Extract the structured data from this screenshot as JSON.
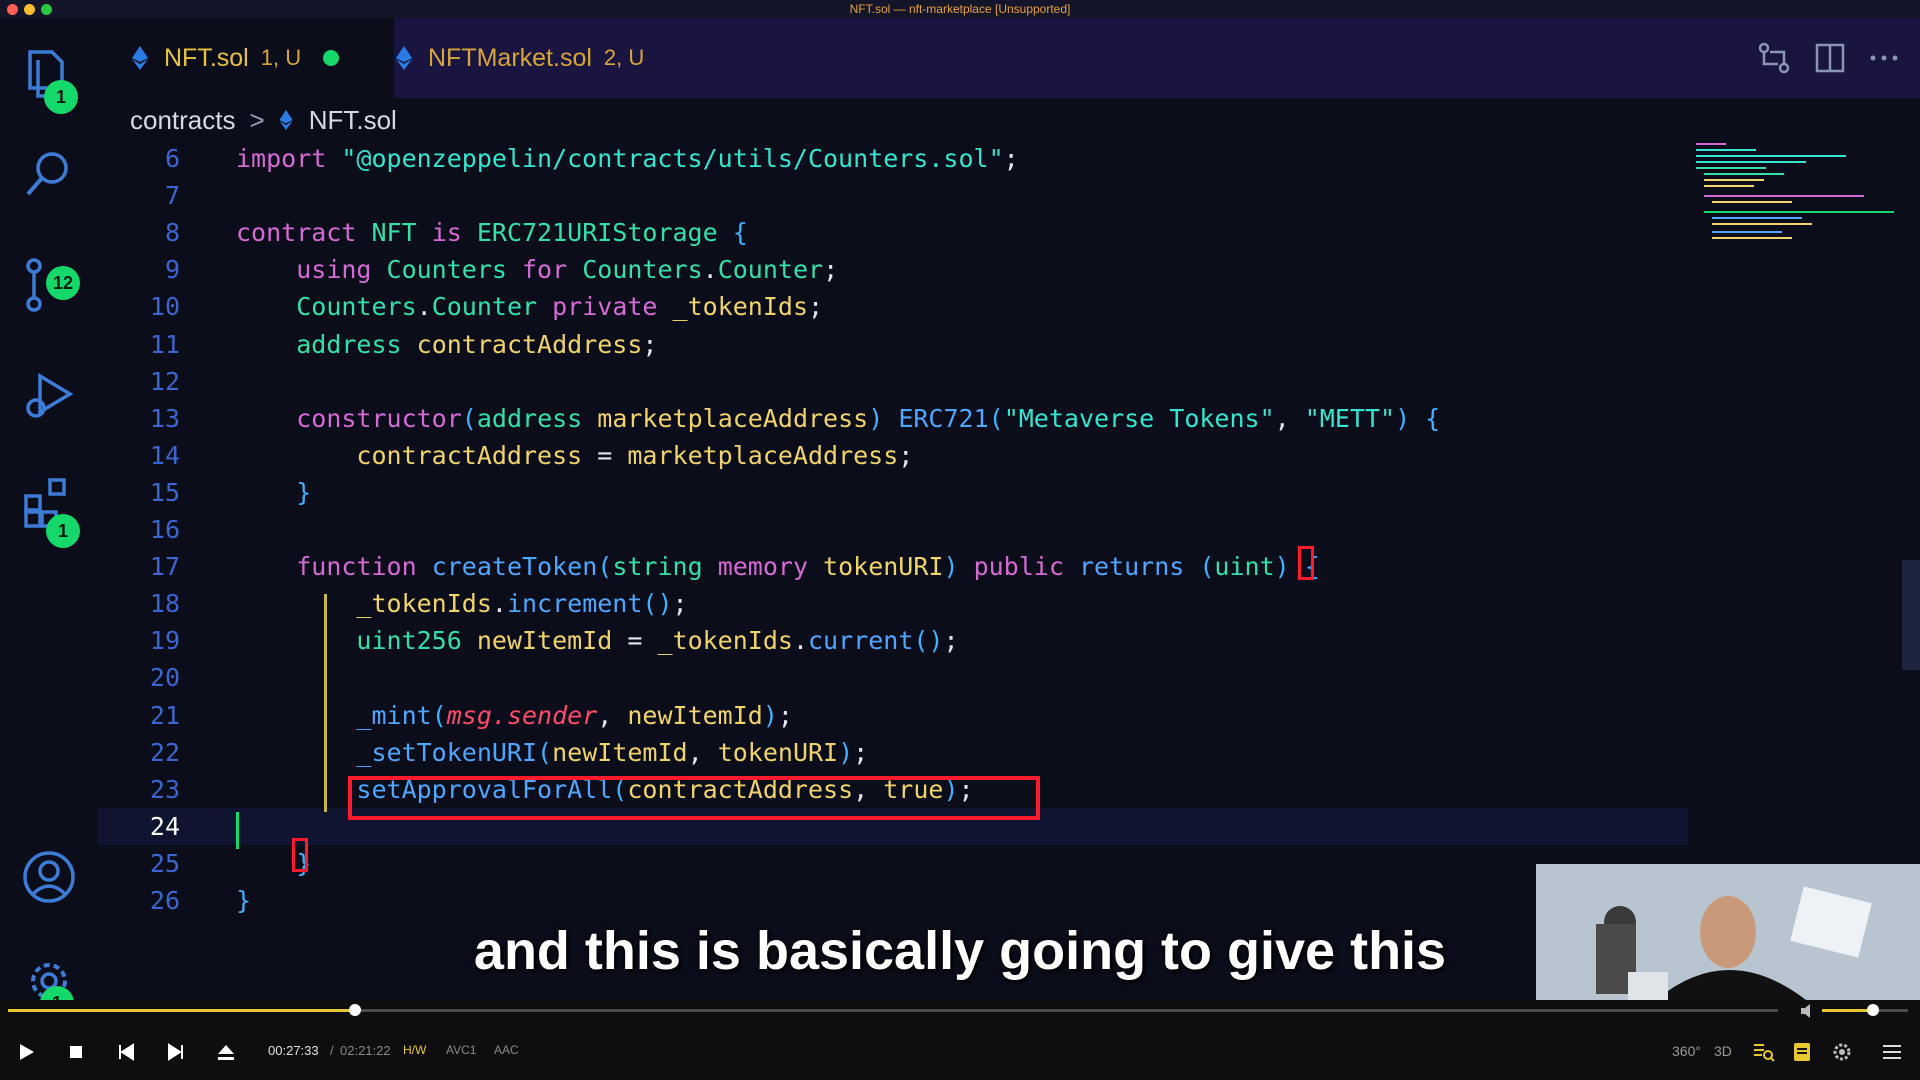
{
  "window": {
    "title": "NFT.sol — nft-marketplace [Unsupported]"
  },
  "activity": {
    "explorer_badge": "1",
    "scm_badge": "12",
    "extensions_badge": "1",
    "settings_badge": "1"
  },
  "tabs": [
    {
      "name": "NFT.sol",
      "meta": "1, U"
    },
    {
      "name": "NFTMarket.sol",
      "meta": "2, U"
    }
  ],
  "breadcrumb": {
    "folder": "contracts",
    "file": "NFT.sol"
  },
  "code_lines": [
    {
      "n": "6",
      "tokens": [
        [
          "kw",
          "import "
        ],
        [
          "str",
          "\"@openzeppelin/contracts/utils/Counters.sol\""
        ],
        [
          "plain",
          ";"
        ]
      ]
    },
    {
      "n": "7",
      "tokens": []
    },
    {
      "n": "8",
      "tokens": [
        [
          "kw",
          "contract "
        ],
        [
          "ty",
          "NFT "
        ],
        [
          "kw",
          "is "
        ],
        [
          "ty",
          "ERC721URIStorage "
        ],
        [
          "punct",
          "{"
        ]
      ]
    },
    {
      "n": "9",
      "tokens": [
        [
          "plain",
          "    "
        ],
        [
          "kw",
          "using "
        ],
        [
          "ty",
          "Counters "
        ],
        [
          "kw",
          "for "
        ],
        [
          "ty",
          "Counters"
        ],
        [
          "plain",
          "."
        ],
        [
          "ty",
          "Counter"
        ],
        [
          "plain",
          ";"
        ]
      ]
    },
    {
      "n": "10",
      "tokens": [
        [
          "plain",
          "    "
        ],
        [
          "ty",
          "Counters"
        ],
        [
          "plain",
          "."
        ],
        [
          "ty",
          "Counter "
        ],
        [
          "kw",
          "private "
        ],
        [
          "id",
          "_tokenIds"
        ],
        [
          "plain",
          ";"
        ]
      ]
    },
    {
      "n": "11",
      "tokens": [
        [
          "plain",
          "    "
        ],
        [
          "ty",
          "address "
        ],
        [
          "id",
          "contractAddress"
        ],
        [
          "plain",
          ";"
        ]
      ]
    },
    {
      "n": "12",
      "tokens": []
    },
    {
      "n": "13",
      "tokens": [
        [
          "plain",
          "    "
        ],
        [
          "kw",
          "constructor"
        ],
        [
          "punct",
          "("
        ],
        [
          "ty",
          "address "
        ],
        [
          "id",
          "marketplaceAddress"
        ],
        [
          "punct",
          ") "
        ],
        [
          "fn",
          "ERC721"
        ],
        [
          "punct",
          "("
        ],
        [
          "str",
          "\"Metaverse Tokens\""
        ],
        [
          "plain",
          ", "
        ],
        [
          "str",
          "\"METT\""
        ],
        [
          "punct",
          ") {"
        ]
      ]
    },
    {
      "n": "14",
      "tokens": [
        [
          "plain",
          "        "
        ],
        [
          "id",
          "contractAddress "
        ],
        [
          "plain",
          "= "
        ],
        [
          "id",
          "marketplaceAddress"
        ],
        [
          "plain",
          ";"
        ]
      ]
    },
    {
      "n": "15",
      "tokens": [
        [
          "plain",
          "    "
        ],
        [
          "punct",
          "}"
        ]
      ]
    },
    {
      "n": "16",
      "tokens": []
    },
    {
      "n": "17",
      "tokens": [
        [
          "plain",
          "    "
        ],
        [
          "kw",
          "function "
        ],
        [
          "fn",
          "createToken"
        ],
        [
          "punct",
          "("
        ],
        [
          "ty",
          "string "
        ],
        [
          "kw",
          "memory "
        ],
        [
          "id",
          "tokenURI"
        ],
        [
          "punct",
          ") "
        ],
        [
          "kw",
          "public "
        ],
        [
          "fn",
          "returns "
        ],
        [
          "punct",
          "("
        ],
        [
          "ty",
          "uint"
        ],
        [
          "punct",
          ") "
        ],
        [
          "punct",
          "{"
        ]
      ]
    },
    {
      "n": "18",
      "tokens": [
        [
          "plain",
          "        "
        ],
        [
          "id",
          "_tokenIds"
        ],
        [
          "plain",
          "."
        ],
        [
          "fn",
          "increment"
        ],
        [
          "punct",
          "()"
        ],
        [
          "plain",
          ";"
        ]
      ]
    },
    {
      "n": "19",
      "tokens": [
        [
          "plain",
          "        "
        ],
        [
          "ty",
          "uint256 "
        ],
        [
          "id",
          "newItemId "
        ],
        [
          "plain",
          "= "
        ],
        [
          "id",
          "_tokenIds"
        ],
        [
          "plain",
          "."
        ],
        [
          "fn",
          "current"
        ],
        [
          "punct",
          "()"
        ],
        [
          "plain",
          ";"
        ]
      ]
    },
    {
      "n": "20",
      "tokens": []
    },
    {
      "n": "21",
      "tokens": [
        [
          "plain",
          "        "
        ],
        [
          "fn",
          "_mint"
        ],
        [
          "punct",
          "("
        ],
        [
          "it",
          "msg.sender"
        ],
        [
          "plain",
          ", "
        ],
        [
          "id",
          "newItemId"
        ],
        [
          "punct",
          ")"
        ],
        [
          "plain",
          ";"
        ]
      ]
    },
    {
      "n": "22",
      "tokens": [
        [
          "plain",
          "        "
        ],
        [
          "fn",
          "_setTokenURI"
        ],
        [
          "punct",
          "("
        ],
        [
          "id",
          "newItemId"
        ],
        [
          "plain",
          ", "
        ],
        [
          "id",
          "tokenURI"
        ],
        [
          "punct",
          ")"
        ],
        [
          "plain",
          ";"
        ]
      ]
    },
    {
      "n": "23",
      "tokens": [
        [
          "plain",
          "        "
        ],
        [
          "fn",
          "setApprovalForAll"
        ],
        [
          "punct",
          "("
        ],
        [
          "id",
          "contractAddress"
        ],
        [
          "plain",
          ", "
        ],
        [
          "id",
          "true"
        ],
        [
          "punct",
          ")"
        ],
        [
          "plain",
          ";"
        ]
      ]
    },
    {
      "n": "24",
      "tokens": []
    },
    {
      "n": "25",
      "tokens": [
        [
          "plain",
          "    "
        ],
        [
          "punct",
          "}"
        ]
      ]
    },
    {
      "n": "26",
      "tokens": [
        [
          "punct",
          "}"
        ]
      ]
    }
  ],
  "subtitle": "and this is basically going to give this",
  "player": {
    "current_time": "00:27:33",
    "separator": "/",
    "total_time": "02:21:22",
    "hw": "H/W",
    "video_codec": "AVC1",
    "audio_codec": "AAC",
    "progress": 0.196,
    "label_360": "360°",
    "label_3d": "3D",
    "accent": "#e6c830"
  },
  "colors": {
    "badge": "#15d86a",
    "highlight_box": "#ff1a2e",
    "tab_text": "#e8c341"
  }
}
